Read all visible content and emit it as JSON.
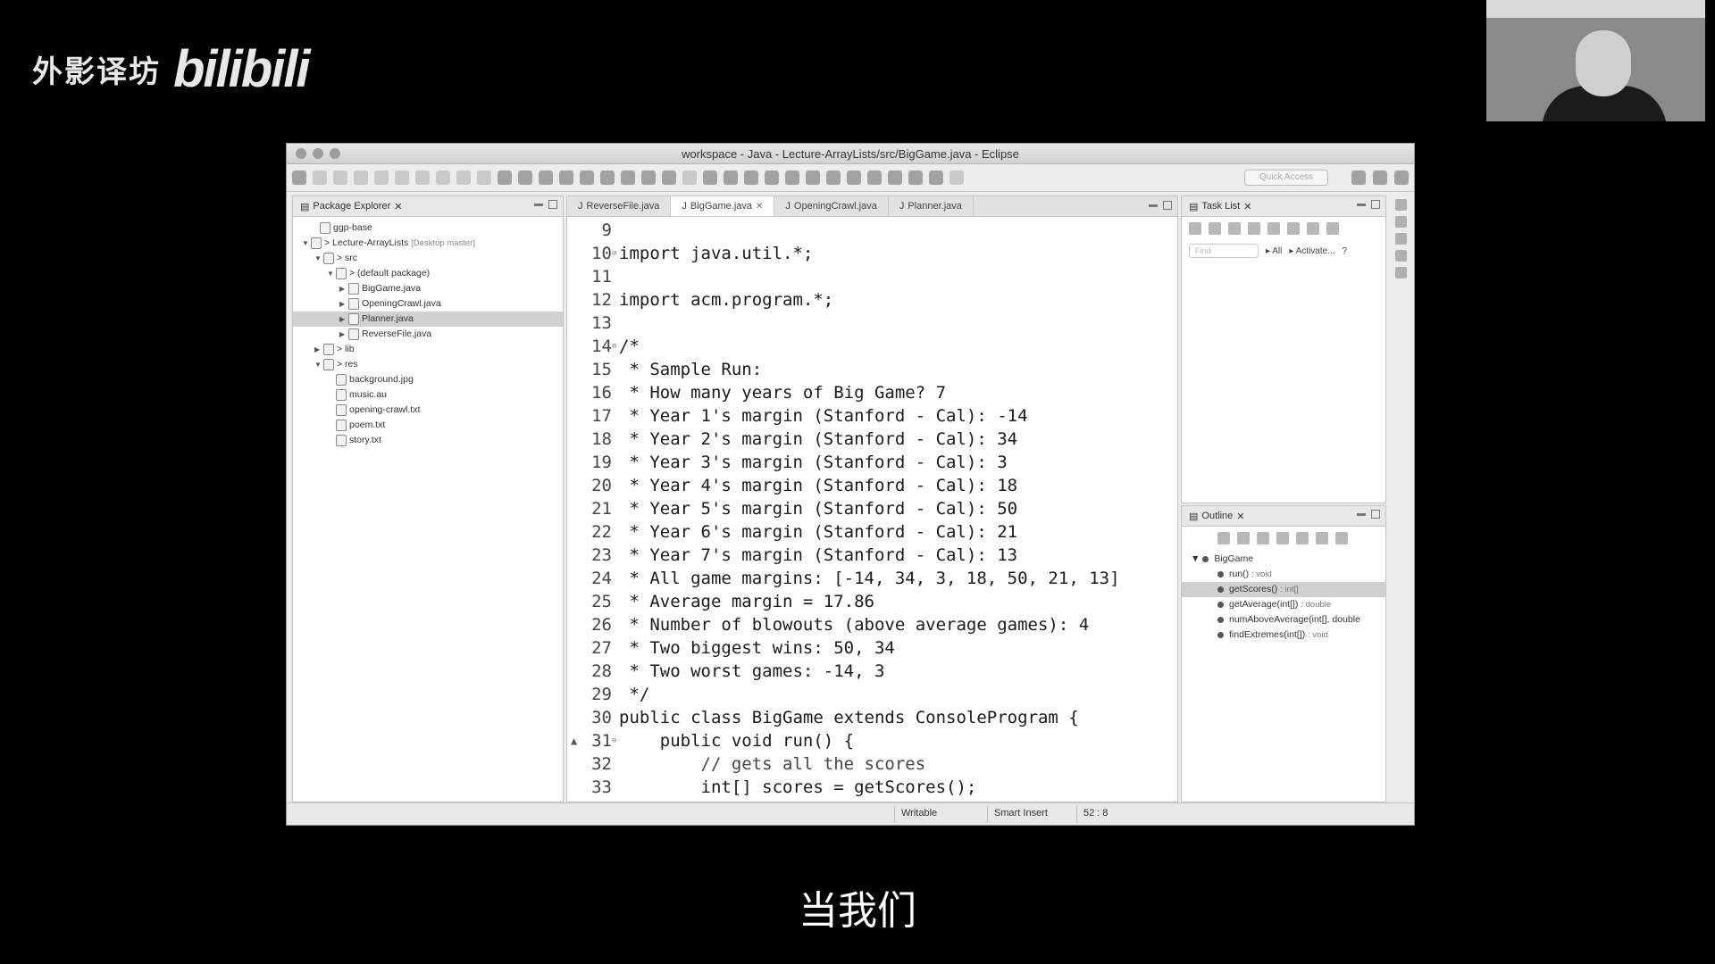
{
  "watermark": {
    "text": "外影译坊",
    "logo": "bilibili"
  },
  "window": {
    "title": "workspace - Java - Lecture-ArrayLists/src/BigGame.java - Eclipse"
  },
  "toolbar": {
    "quick_access_placeholder": "Quick Access"
  },
  "package_explorer": {
    "tab_label": "Package Explorer",
    "items": [
      {
        "label": "ggp-base",
        "decoration": ""
      },
      {
        "label": "> Lecture-ArrayLists",
        "decoration": "[Desktop master]"
      },
      {
        "label": "> src",
        "decoration": ""
      },
      {
        "label": "> (default package)",
        "decoration": ""
      },
      {
        "label": "BigGame.java",
        "decoration": ""
      },
      {
        "label": "OpeningCrawl.java",
        "decoration": ""
      },
      {
        "label": "Planner.java",
        "decoration": ""
      },
      {
        "label": "ReverseFile.java",
        "decoration": ""
      },
      {
        "label": "> lib",
        "decoration": ""
      },
      {
        "label": "> res",
        "decoration": ""
      },
      {
        "label": "background.jpg",
        "decoration": ""
      },
      {
        "label": "music.au",
        "decoration": ""
      },
      {
        "label": "opening-crawl.txt",
        "decoration": ""
      },
      {
        "label": "poem.txt",
        "decoration": ""
      },
      {
        "label": "story.txt",
        "decoration": ""
      }
    ]
  },
  "editor": {
    "tabs": [
      {
        "label": "ReverseFile.java"
      },
      {
        "label": "BigGame.java"
      },
      {
        "label": "OpeningCrawl.java"
      },
      {
        "label": "Planner.java"
      }
    ],
    "lines": [
      {
        "n": "9",
        "code": ""
      },
      {
        "n": "10",
        "code": "import java.util.*;"
      },
      {
        "n": "11",
        "code": ""
      },
      {
        "n": "12",
        "code": "import acm.program.*;"
      },
      {
        "n": "13",
        "code": ""
      },
      {
        "n": "14",
        "code": "/*"
      },
      {
        "n": "15",
        "code": " * Sample Run:"
      },
      {
        "n": "16",
        "code": " * How many years of Big Game? 7"
      },
      {
        "n": "17",
        "code": " * Year 1's margin (Stanford - Cal): -14"
      },
      {
        "n": "18",
        "code": " * Year 2's margin (Stanford - Cal): 34"
      },
      {
        "n": "19",
        "code": " * Year 3's margin (Stanford - Cal): 3"
      },
      {
        "n": "20",
        "code": " * Year 4's margin (Stanford - Cal): 18"
      },
      {
        "n": "21",
        "code": " * Year 5's margin (Stanford - Cal): 50"
      },
      {
        "n": "22",
        "code": " * Year 6's margin (Stanford - Cal): 21"
      },
      {
        "n": "23",
        "code": " * Year 7's margin (Stanford - Cal): 13"
      },
      {
        "n": "24",
        "code": " * All game margins: [-14, 34, 3, 18, 50, 21, 13]"
      },
      {
        "n": "25",
        "code": " * Average margin = 17.86"
      },
      {
        "n": "26",
        "code": " * Number of blowouts (above average games): 4"
      },
      {
        "n": "27",
        "code": " * Two biggest wins: 50, 34"
      },
      {
        "n": "28",
        "code": " * Two worst games: -14, 3"
      },
      {
        "n": "29",
        "code": " */"
      },
      {
        "n": "30",
        "code": "public class BigGame extends ConsoleProgram {"
      },
      {
        "n": "31",
        "code": "    public void run() {"
      },
      {
        "n": "32",
        "code": "        // gets all the scores"
      },
      {
        "n": "33",
        "code": "        int[] scores = getScores();"
      }
    ]
  },
  "task_list": {
    "tab_label": "Task List",
    "find_placeholder": "Find",
    "all_label": "All",
    "activate_label": "Activate..."
  },
  "outline": {
    "tab_label": "Outline",
    "class_name": "BigGame",
    "members": [
      {
        "name": "run()",
        "sig": ": void"
      },
      {
        "name": "getScores()",
        "sig": ": int[]"
      },
      {
        "name": "getAverage(int[])",
        "sig": ": double"
      },
      {
        "name": "numAboveAverage(int[], double",
        "sig": ""
      },
      {
        "name": "findExtremes(int[])",
        "sig": ": void"
      }
    ]
  },
  "status": {
    "writable": "Writable",
    "insert_mode": "Smart Insert",
    "position": "52 : 8"
  },
  "subtitle": "当我们"
}
